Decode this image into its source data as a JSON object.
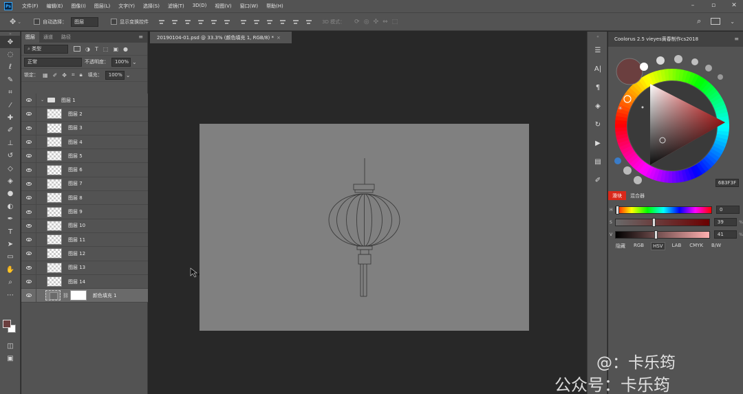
{
  "menubar": {
    "logo": "Ps",
    "items": [
      "文件(F)",
      "编辑(E)",
      "图像(I)",
      "图层(L)",
      "文字(Y)",
      "选择(S)",
      "滤镜(T)",
      "3D(D)",
      "视图(V)",
      "窗口(W)",
      "帮助(H)"
    ]
  },
  "options": {
    "auto_select_label": "自动选择：",
    "auto_select_value": "图层",
    "show_transform_label": "显示变换控件",
    "mode3d_label": "3D 模式："
  },
  "layers_panel": {
    "tabs": [
      "图层",
      "通道",
      "路径"
    ],
    "filter_label": "类型",
    "blend_mode": "正常",
    "opacity_label": "不透明度：",
    "opacity_value": "100%",
    "lock_label": "锁定：",
    "fill_label": "填充：",
    "fill_value": "100%",
    "group_name": "图层 1",
    "layers": [
      "图层 2",
      "图层 3",
      "图层 4",
      "图层 5",
      "图层 6",
      "图层 7",
      "图层 8",
      "图层 9",
      "图层 10",
      "图层 11",
      "图层 12",
      "图层 13",
      "图层 14"
    ],
    "fill_layer_name": "颜色填充 1"
  },
  "document": {
    "tab_title": "20190104-01.psd @ 33.3% (颜色填充 1, RGB/8) *",
    "tab_close": "×",
    "canvas_color": "#808080"
  },
  "colors": {
    "foreground": "#6b3f3f",
    "background": "#ffffff"
  },
  "color_panel": {
    "title": "Coolorus 2.5 vieyes黄春制作cs2018",
    "hex_value": "6B3F3F",
    "mode_tabs": [
      "滑块",
      "混合器"
    ],
    "sliders": [
      {
        "label": "H",
        "value": "0",
        "pct": "",
        "level": 0.0
      },
      {
        "label": "S",
        "value": "39",
        "pct": "%",
        "level": 0.39
      },
      {
        "label": "V",
        "value": "41",
        "pct": "%",
        "level": 0.41
      }
    ],
    "model_tabs": [
      "隐藏",
      "RGB",
      "HSV",
      "LAB",
      "CMYK",
      "B/W"
    ]
  },
  "watermark": {
    "line1": "@：卡乐筠",
    "line2": "公众号：卡乐筠"
  }
}
